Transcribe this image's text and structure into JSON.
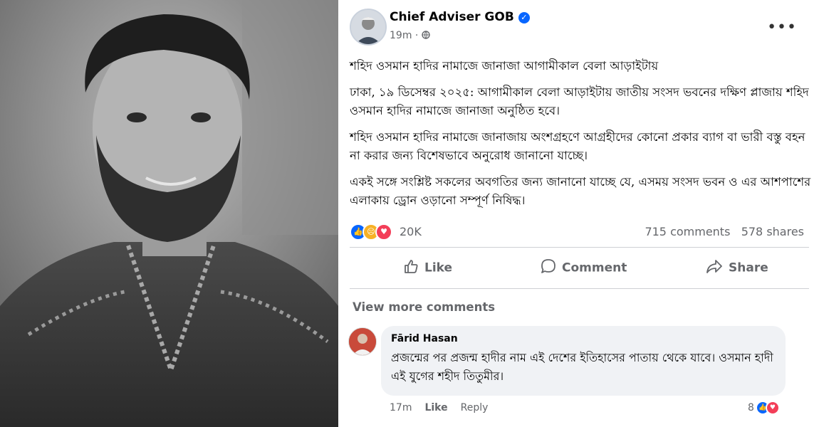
{
  "post": {
    "author": "Chief Adviser GOB",
    "time": "19m",
    "title_line": "শহিদ ওসমান হাদির নামাজে জানাজা আগামীকাল বেলা আড়াইটায়",
    "paragraph_1": "ঢাকা, ১৯ ডিসেম্বর ২০২৫: আগামীকাল বেলা আড়াইটায় জাতীয় সংসদ ভবনের দক্ষিণ প্লাজায় শহিদ ওসমান হাদির নামাজে জানাজা অনুষ্ঠিত হবে।",
    "paragraph_2": "শহিদ ওসমান হাদির নামাজে জানাজায় অংশগ্রহণে আগ্রহীদের কোনো প্রকার ব্যাগ বা ভারী বস্তু বহন না করার জন্য বিশেষভাবে অনুরোধ জানানো যাচ্ছে।",
    "paragraph_3": "একই সঙ্গে সংশ্লিষ্ট সকলের অবগতির জন্য জানানো যাচ্ছে যে, এসময় সংসদ ভবন ও এর আশপাশের এলাকায় ড্রোন ওড়ানো সম্পূর্ণ নিষিদ্ধ।",
    "reactions_count": "20K",
    "comments_count": "715 comments",
    "shares_count": "578 shares"
  },
  "actions": {
    "like": "Like",
    "comment": "Comment",
    "share": "Share"
  },
  "comments": {
    "view_more": "View more comments",
    "items": [
      {
        "author": "Fārid Hasan",
        "text": "প্রজন্মের পর প্রজন্ম হাদীর নাম এই দেশের ইতিহাসের পাতায় থেকে যাবে। ওসমান হাদী এই যুগের শহীদ তিতুমীর।",
        "time": "17m",
        "like": "Like",
        "reply": "Reply",
        "reactions": "8"
      }
    ]
  },
  "colors": {
    "fb_blue": "#0866ff",
    "muted": "#65676b",
    "bubble": "#f0f2f5",
    "heart": "#f33e58",
    "haha": "#f7b125"
  },
  "icons": [
    "verified-icon",
    "globe-icon",
    "more-icon",
    "like-icon",
    "comment-icon",
    "share-icon",
    "like-reaction-icon",
    "sad-reaction-icon",
    "love-reaction-icon"
  ]
}
